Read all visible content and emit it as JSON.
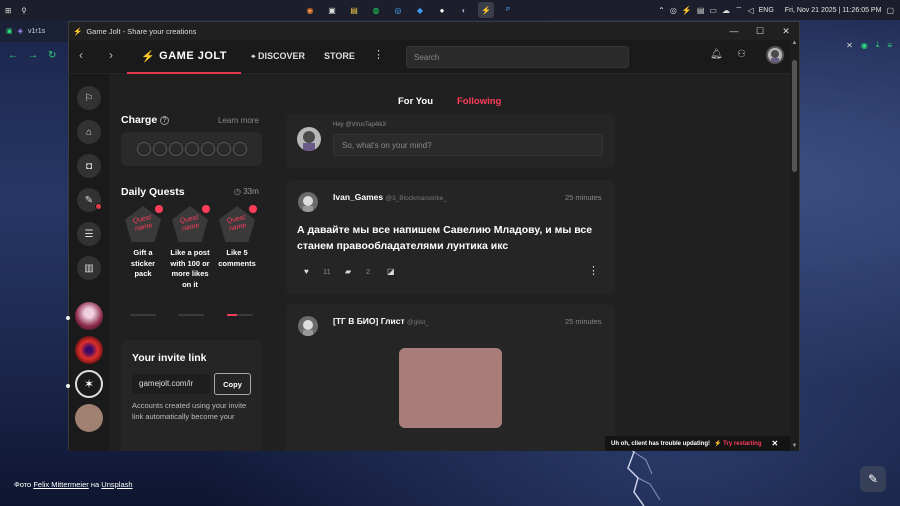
{
  "taskbar": {
    "language": "ENG",
    "clock": "Fri, Nov 21 2025 | 11:26:05 PM"
  },
  "background": {
    "tab_label": "v1r1s",
    "credit_prefix": "Фото",
    "credit_author": "Felix Mittermeier",
    "credit_middle": "на",
    "credit_site": "Unsplash"
  },
  "window": {
    "title": "Game Jolt - Share your creations"
  },
  "nav": {
    "logo": "GAME JOLT",
    "discover": "DISCOVER",
    "store": "STORE",
    "search_placeholder": "Search"
  },
  "feed_tabs": {
    "for_you": "For You",
    "following": "Following"
  },
  "charge": {
    "title": "Charge",
    "learn_more": "Learn more",
    "orbs": 7
  },
  "quests": {
    "title": "Daily Quests",
    "timer": "33m",
    "icon_text": "Quest name",
    "items": [
      {
        "label": "Gift a sticker pack",
        "progress": 0
      },
      {
        "label": "Like a post with 100 or more likes on it",
        "progress": 0
      },
      {
        "label": "Like 5 comments",
        "progress": 0.4
      }
    ]
  },
  "invite": {
    "title": "Your invite link",
    "url": "gamejolt.com/ir",
    "copy_label": "Copy",
    "description": "Accounts created using your invite link automatically become your"
  },
  "composer": {
    "greeting": "Hey @VirusTap4ikX",
    "placeholder": "So, what's on your mind?"
  },
  "posts": [
    {
      "name": "Ivan_Games",
      "handle": "@3_Blockmanstrike_",
      "time": "25 minutes",
      "body": "А давайте мы все напишем Савелию Младову, и мы все станем правообладателями лунтика икс",
      "likes": "11",
      "comments": "2"
    },
    {
      "name": "[ТГ В БИО] Глист",
      "handle": "@glist_",
      "time": "25 minutes"
    }
  ],
  "banner": {
    "message": "Uh oh, client has trouble updating!",
    "action": "Try restarting"
  },
  "colors": {
    "accent": "#ff3d5a",
    "app_bg": "#191919",
    "panel_bg": "#252525"
  }
}
